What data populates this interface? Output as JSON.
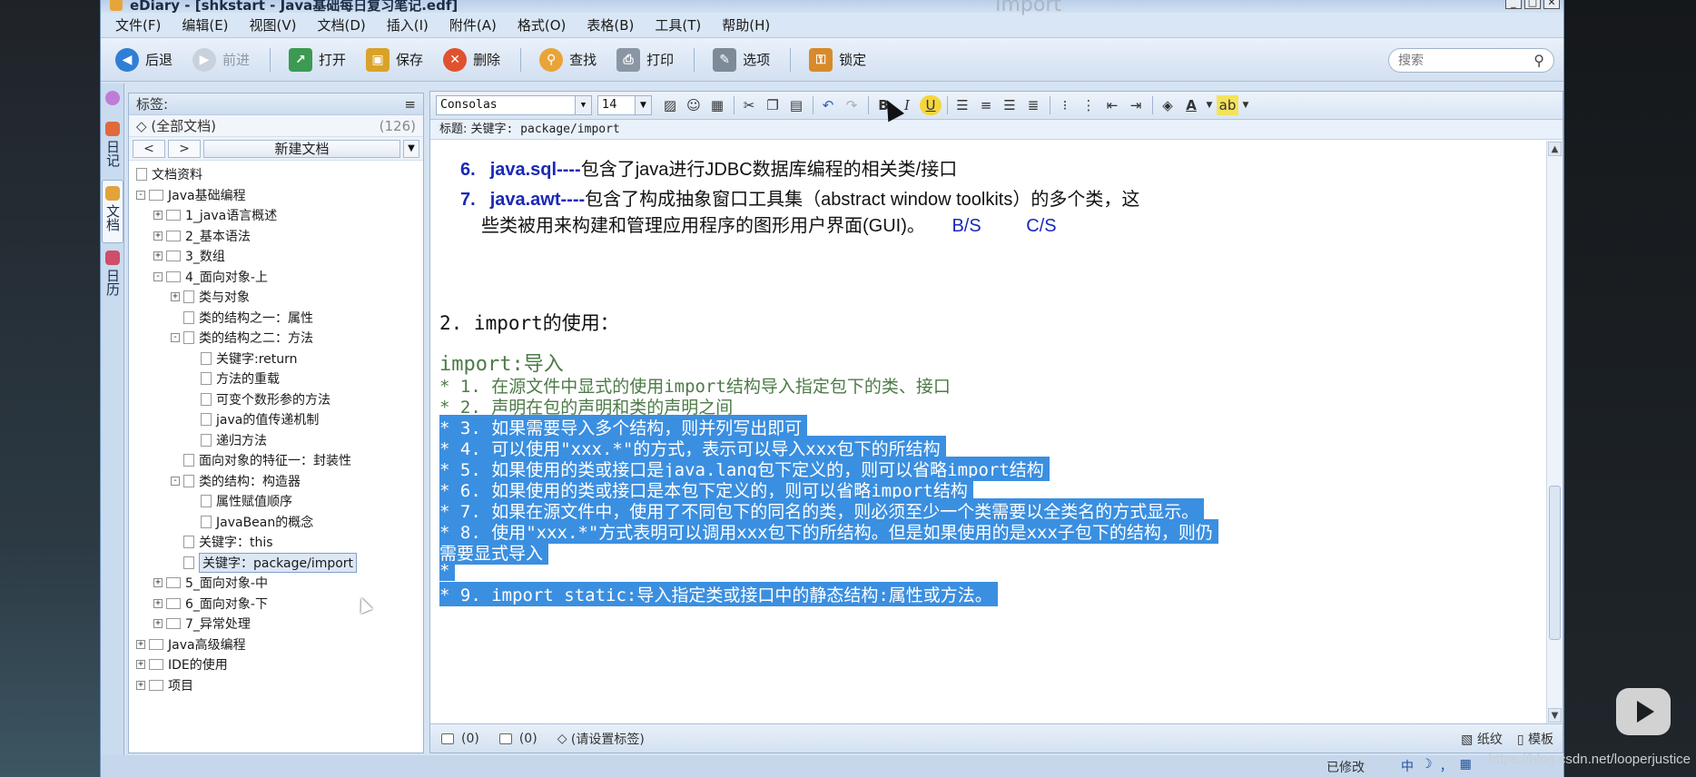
{
  "window": {
    "title": "eDiary - [shkstart - Java基础每日复习笔记.edf]",
    "overlay_title": "Import",
    "minimize": "_",
    "maximize": "□",
    "close": "✕"
  },
  "menu": [
    "文件(F)",
    "编辑(E)",
    "视图(V)",
    "文档(D)",
    "插入(I)",
    "附件(A)",
    "格式(O)",
    "表格(B)",
    "工具(T)",
    "帮助(H)"
  ],
  "toolbar": {
    "back": "后退",
    "forward": "前进",
    "open": "打开",
    "save": "保存",
    "delete": "删除",
    "find": "查找",
    "print": "打印",
    "options": "选项",
    "lock": "锁定",
    "search_placeholder": "搜索"
  },
  "vtabs": {
    "diary": "日记",
    "docs": "文档",
    "calendar": "日历"
  },
  "sidebar": {
    "tags_label": "标签:",
    "all_docs": "(全部文档)",
    "all_docs_count": "(126)",
    "prev": "<",
    "next": ">",
    "new_doc": "新建文档",
    "tree": [
      {
        "label": "文档资料",
        "level": 0,
        "kind": "root"
      },
      {
        "label": "Java基础编程",
        "level": 0,
        "kind": "folder",
        "exp": "−"
      },
      {
        "label": "1_java语言概述",
        "level": 1,
        "kind": "folder",
        "exp": "+"
      },
      {
        "label": "2_基本语法",
        "level": 1,
        "kind": "folder",
        "exp": "+"
      },
      {
        "label": "3_数组",
        "level": 1,
        "kind": "folder",
        "exp": "+"
      },
      {
        "label": "4_面向对象-上",
        "level": 1,
        "kind": "folder",
        "exp": "−"
      },
      {
        "label": "类与对象",
        "level": 2,
        "kind": "doc",
        "exp": "+"
      },
      {
        "label": "类的结构之一：属性",
        "level": 2,
        "kind": "doc"
      },
      {
        "label": "类的结构之二：方法",
        "level": 2,
        "kind": "doc",
        "exp": "−"
      },
      {
        "label": "关键字:return",
        "level": 3,
        "kind": "doc"
      },
      {
        "label": "方法的重载",
        "level": 3,
        "kind": "doc"
      },
      {
        "label": "可变个数形参的方法",
        "level": 3,
        "kind": "doc"
      },
      {
        "label": "java的值传递机制",
        "level": 3,
        "kind": "doc"
      },
      {
        "label": "递归方法",
        "level": 3,
        "kind": "doc"
      },
      {
        "label": "面向对象的特征一：封装性",
        "level": 2,
        "kind": "doc"
      },
      {
        "label": "类的结构：构造器",
        "level": 2,
        "kind": "doc",
        "exp": "−"
      },
      {
        "label": "属性赋值顺序",
        "level": 3,
        "kind": "doc"
      },
      {
        "label": "JavaBean的概念",
        "level": 3,
        "kind": "doc"
      },
      {
        "label": "关键字：this",
        "level": 2,
        "kind": "doc"
      },
      {
        "label": "关键字：package/import",
        "level": 2,
        "kind": "doc",
        "selected": true
      },
      {
        "label": "5_面向对象-中",
        "level": 1,
        "kind": "folder",
        "exp": "+"
      },
      {
        "label": "6_面向对象-下",
        "level": 1,
        "kind": "folder",
        "exp": "+"
      },
      {
        "label": "7_异常处理",
        "level": 1,
        "kind": "folder",
        "exp": "+"
      },
      {
        "label": "Java高级编程",
        "level": 0,
        "kind": "folder",
        "exp": "+"
      },
      {
        "label": "IDE的使用",
        "level": 0,
        "kind": "folder",
        "exp": "+"
      },
      {
        "label": "项目",
        "level": 0,
        "kind": "folder",
        "exp": "+"
      }
    ]
  },
  "format_bar": {
    "font": "Consolas",
    "size": "14",
    "bold": "B",
    "italic": "I",
    "underline": "U"
  },
  "doc": {
    "title_label": "标题:",
    "title_value": "关键字: package/import",
    "pkg6_num": "6.",
    "pkg6_kw": "java.sql----",
    "pkg6_text": "包含了java进行JDBC数据库编程的相关类/接口",
    "pkg7_num": "7.",
    "pkg7_kw": "java.awt----",
    "pkg7_text": "包含了构成抽象窗口工具集（abstract window toolkits）的多个类，这",
    "pkg7_text2": "些类被用来构建和管理应用程序的图形用户界面(GUI)。",
    "bs": "B/S",
    "cs": "C/S",
    "section_title": "2. import的使用：",
    "import_heading": "import:导入",
    "lines": [
      " * 1. 在源文件中显式的使用import结构导入指定包下的类、接口",
      " * 2. 声明在包的声明和类的声明之间",
      " * 3. 如果需要导入多个结构，则并列写出即可",
      " * 4. 可以使用\"xxx.*\"的方式，表示可以导入xxx包下的所结构",
      " * 5. 如果使用的类或接口是java.lang包下定义的，则可以省略import结构",
      " * 6. 如果使用的类或接口是本包下定义的，则可以省略import结构",
      " * 7. 如果在源文件中，使用了不同包下的同名的类，则必须至少一个类需要以全类名的方式显示。",
      " * 8. 使用\"xxx.*\"方式表明可以调用xxx包下的所结构。但是如果使用的是xxx子包下的结构，则仍",
      "需要显式导入",
      " *",
      " * 9. import static:导入指定类或接口中的静态结构:属性或方法。"
    ]
  },
  "statusbar": {
    "attach_count": "(0)",
    "comment_count": "(0)",
    "tag_hint": "(请设置标签)",
    "paper": "纸纹",
    "template": "模板",
    "modified": "已修改"
  },
  "ime": [
    "中",
    "☽",
    "，",
    "▦"
  ],
  "watermark": "https://blog.csdn.net/looperjustice"
}
